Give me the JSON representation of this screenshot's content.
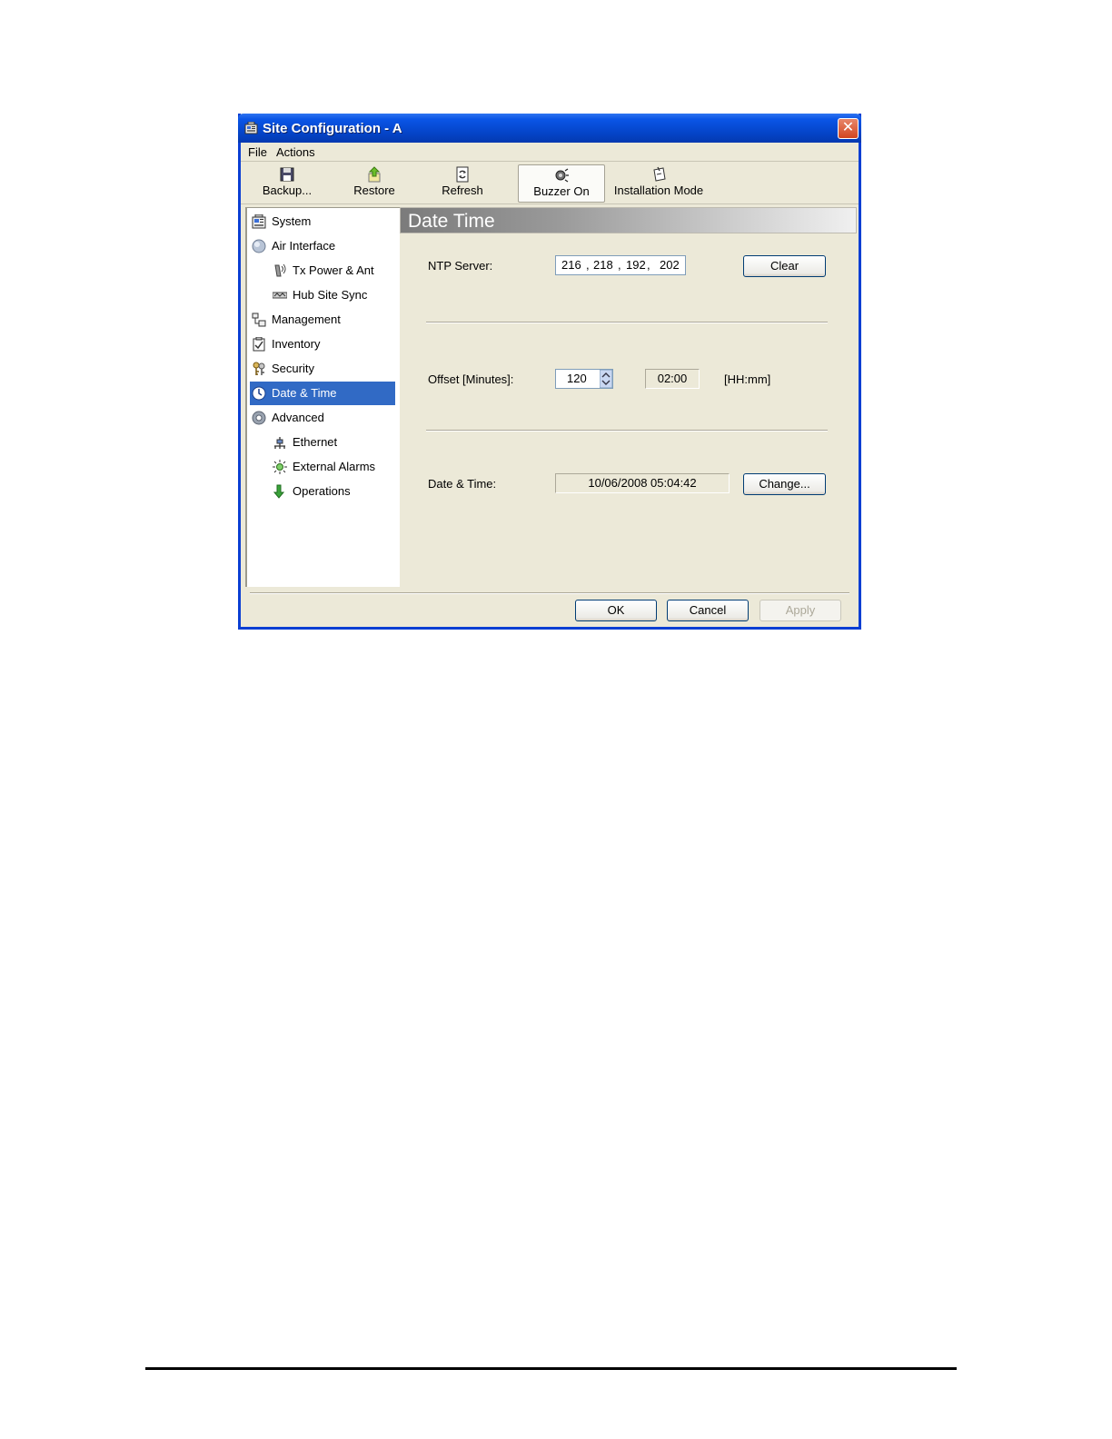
{
  "window": {
    "title": "Site Configuration - A",
    "close_label": "✕"
  },
  "menu": [
    "File",
    "Actions"
  ],
  "toolbar": [
    {
      "label": "Backup...",
      "icon": "floppy-icon"
    },
    {
      "label": "Restore",
      "icon": "restore-arrow-icon"
    },
    {
      "label": "Refresh",
      "icon": "refresh-icon"
    },
    {
      "label": "Buzzer On",
      "icon": "buzzer-icon"
    },
    {
      "label": "Installation Mode",
      "icon": "installation-icon"
    }
  ],
  "sidebar": {
    "items": [
      {
        "label": "System",
        "icon": "system-icon"
      },
      {
        "label": "Air Interface",
        "icon": "air-interface-icon"
      },
      {
        "label": "Tx Power & Ant",
        "icon": "antenna-icon"
      },
      {
        "label": "Hub Site Sync",
        "icon": "sync-icon"
      },
      {
        "label": "Management",
        "icon": "management-icon"
      },
      {
        "label": "Inventory",
        "icon": "inventory-icon"
      },
      {
        "label": "Security",
        "icon": "keys-icon"
      },
      {
        "label": "Date & Time",
        "icon": "clock-icon"
      },
      {
        "label": "Advanced",
        "icon": "gear-icon"
      },
      {
        "label": "Ethernet",
        "icon": "ethernet-icon"
      },
      {
        "label": "External Alarms",
        "icon": "alarm-icon"
      },
      {
        "label": "Operations",
        "icon": "operations-arrow-icon"
      }
    ],
    "selected": "Date & Time"
  },
  "panel": {
    "title": "Date  Time",
    "ntp": {
      "label": "NTP Server:",
      "octets": [
        "216",
        "218",
        "192",
        "202"
      ],
      "separators": [
        ",",
        ",",
        ","
      ],
      "clear_label": "Clear"
    },
    "offset": {
      "label": "Offset [Minutes]:",
      "value": "120",
      "hhmm": "02:00",
      "unit": "[HH:mm]"
    },
    "datetime": {
      "label": "Date & Time:",
      "value": "10/06/2008 05:04:42",
      "change_label": "Change..."
    }
  },
  "footer": {
    "ok": "OK",
    "cancel": "Cancel",
    "apply": "Apply"
  },
  "colors": {
    "titlebar": "#0a55e6",
    "selection": "#316ac5",
    "window_bg": "#ece9d8"
  }
}
